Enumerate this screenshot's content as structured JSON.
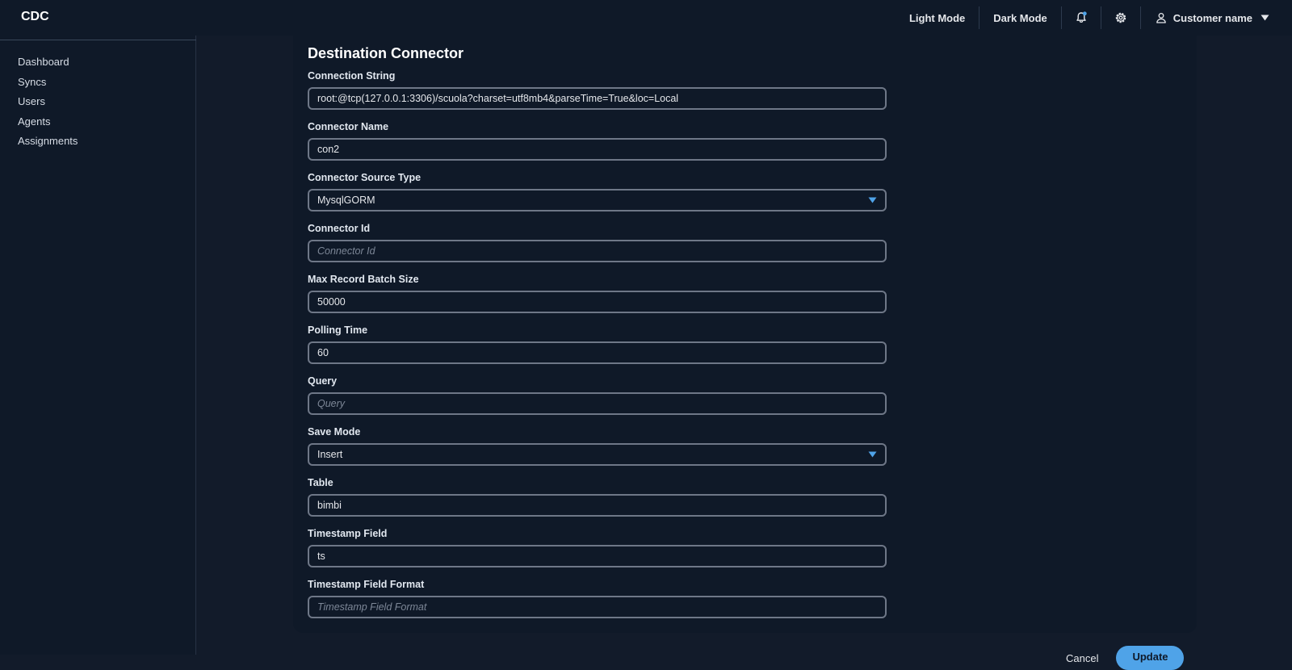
{
  "app": {
    "brand": "CDC"
  },
  "header": {
    "light_mode": "Light Mode",
    "dark_mode": "Dark Mode",
    "user_name": "Customer name",
    "icons": [
      "bell-icon",
      "gear-icon",
      "user-icon",
      "caret-down-icon"
    ]
  },
  "sidebar": {
    "items": [
      {
        "label": "Dashboard"
      },
      {
        "label": "Syncs"
      },
      {
        "label": "Users"
      },
      {
        "label": "Agents"
      },
      {
        "label": "Assignments"
      }
    ]
  },
  "form": {
    "title": "Destination Connector",
    "fields": [
      {
        "label": "Connection String",
        "value": "root:@tcp(127.0.0.1:3306)/scuola?charset=utf8mb4&parseTime=True&loc=Local",
        "placeholder": ""
      },
      {
        "label": "Connector Name",
        "value": "con2",
        "placeholder": ""
      },
      {
        "label": "Connector Source Type",
        "value": "MysqlGORM"
      },
      {
        "label": "Connector Id",
        "value": "",
        "placeholder": "Connector Id"
      },
      {
        "label": "Max Record Batch Size",
        "value": "50000",
        "placeholder": ""
      },
      {
        "label": "Polling Time",
        "value": "60",
        "placeholder": ""
      },
      {
        "label": "Query",
        "value": "",
        "placeholder": "Query"
      },
      {
        "label": "Save Mode",
        "value": "Insert"
      },
      {
        "label": "Table",
        "value": "bimbi",
        "placeholder": ""
      },
      {
        "label": "Timestamp Field",
        "value": "ts",
        "placeholder": ""
      },
      {
        "label": "Timestamp Field Format",
        "value": "",
        "placeholder": "Timestamp Field Format"
      }
    ]
  },
  "actions": {
    "cancel": "Cancel",
    "update": "Update"
  },
  "colors": {
    "background": "#121b2a",
    "panel": "#0f1928",
    "accent": "#4fa3e8",
    "input_border": "#6e7787"
  }
}
